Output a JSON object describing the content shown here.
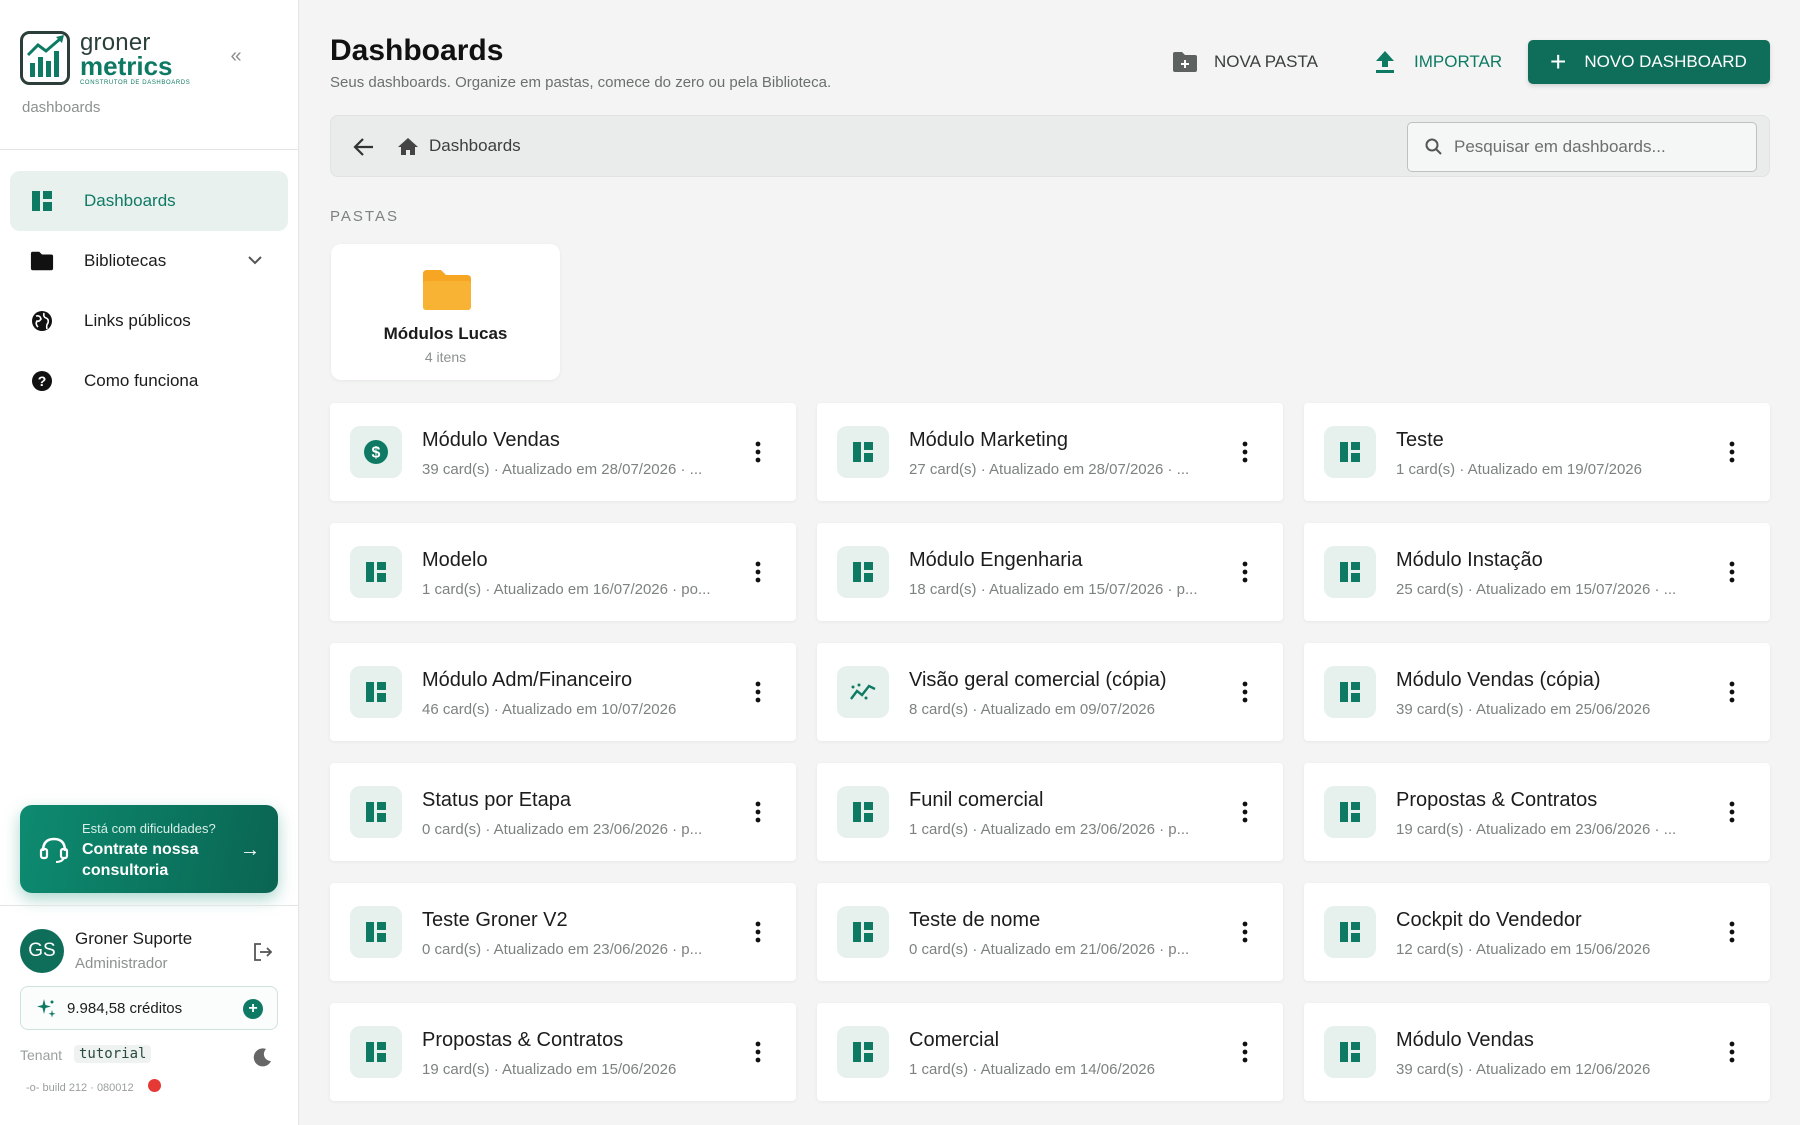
{
  "brand": {
    "name_line1": "groner",
    "name_line2": "metrics",
    "tagline": "CONSTRUTOR DE DASHBOARDS",
    "subtitle": "dashboards",
    "collapse_icon": "chevron-double-left-icon"
  },
  "nav": [
    {
      "label": "Dashboards",
      "icon": "dashboard-icon",
      "active": true
    },
    {
      "label": "Bibliotecas",
      "icon": "folder-icon",
      "active": false,
      "expandable": true
    },
    {
      "label": "Links públicos",
      "icon": "globe-icon",
      "active": false
    },
    {
      "label": "Como funciona",
      "icon": "help-icon",
      "active": false
    }
  ],
  "promo": {
    "line1": "Está com dificuldades?",
    "line2": "Contrate nossa consultoria"
  },
  "user": {
    "initials": "GS",
    "name": "Groner Suporte",
    "role": "Administrador"
  },
  "credits": {
    "text": "9.984,58 créditos"
  },
  "tenant": {
    "label": "Tenant",
    "value": "tutorial"
  },
  "build": {
    "text": "build 212 · 080012"
  },
  "header": {
    "title": "Dashboards",
    "subtitle": "Seus dashboards. Organize em pastas, comece do zero ou pela Biblioteca.",
    "nova_pasta": "NOVA PASTA",
    "importar": "IMPORTAR",
    "novo_dashboard": "NOVO DASHBOARD"
  },
  "toolbar": {
    "breadcrumb": "Dashboards",
    "search_placeholder": "Pesquisar em dashboards..."
  },
  "folders_label": "PASTAS",
  "folders": [
    {
      "name": "Módulos Lucas",
      "count": "4 itens"
    }
  ],
  "dashboards": [
    {
      "title": "Módulo Vendas",
      "meta": "39 card(s) · Atualizado em 28/07/2026 · ...",
      "icon": "dollar-icon"
    },
    {
      "title": "Módulo Marketing",
      "meta": "27 card(s) · Atualizado em 28/07/2026 · ...",
      "icon": "dashboard-icon"
    },
    {
      "title": "Teste",
      "meta": "1 card(s) · Atualizado em 19/07/2026",
      "icon": "dashboard-icon"
    },
    {
      "title": "Modelo",
      "meta": "1 card(s) · Atualizado em 16/07/2026 · po...",
      "icon": "dashboard-icon"
    },
    {
      "title": "Módulo Engenharia",
      "meta": "18 card(s) · Atualizado em 15/07/2026 · p...",
      "icon": "dashboard-icon"
    },
    {
      "title": "Módulo Instação",
      "meta": "25 card(s) · Atualizado em 15/07/2026 · ...",
      "icon": "dashboard-icon"
    },
    {
      "title": "Módulo Adm/Financeiro",
      "meta": "46 card(s) · Atualizado em 10/07/2026",
      "icon": "dashboard-icon"
    },
    {
      "title": "Visão geral comercial (cópia)",
      "meta": "8 card(s) · Atualizado em 09/07/2026",
      "icon": "trend-icon"
    },
    {
      "title": "Módulo Vendas (cópia)",
      "meta": "39 card(s) · Atualizado em 25/06/2026",
      "icon": "dashboard-icon"
    },
    {
      "title": "Status por Etapa",
      "meta": "0 card(s) · Atualizado em 23/06/2026 · p...",
      "icon": "dashboard-icon"
    },
    {
      "title": "Funil comercial",
      "meta": "1 card(s) · Atualizado em 23/06/2026 · p...",
      "icon": "dashboard-icon"
    },
    {
      "title": "Propostas & Contratos",
      "meta": "19 card(s) · Atualizado em 23/06/2026 · ...",
      "icon": "dashboard-icon"
    },
    {
      "title": "Teste Groner V2",
      "meta": "0 card(s) · Atualizado em 23/06/2026 · p...",
      "icon": "dashboard-icon"
    },
    {
      "title": "Teste de nome",
      "meta": "0 card(s) · Atualizado em 21/06/2026 · p...",
      "icon": "dashboard-icon"
    },
    {
      "title": "Cockpit do Vendedor",
      "meta": "12 card(s) · Atualizado em 15/06/2026",
      "icon": "dashboard-icon"
    },
    {
      "title": "Propostas & Contratos",
      "meta": "19 card(s) · Atualizado em 15/06/2026",
      "icon": "dashboard-icon"
    },
    {
      "title": "Comercial",
      "meta": "1 card(s) · Atualizado em 14/06/2026",
      "icon": "dashboard-icon"
    },
    {
      "title": "Módulo Vendas",
      "meta": "39 card(s) · Atualizado em 12/06/2026",
      "icon": "dashboard-icon"
    }
  ],
  "colors": {
    "accent": "#0f7a64",
    "accent_dark": "#0f6e5a",
    "folder": "#f6a623",
    "active_bg": "#e8f1ee",
    "alert": "#e53935"
  }
}
